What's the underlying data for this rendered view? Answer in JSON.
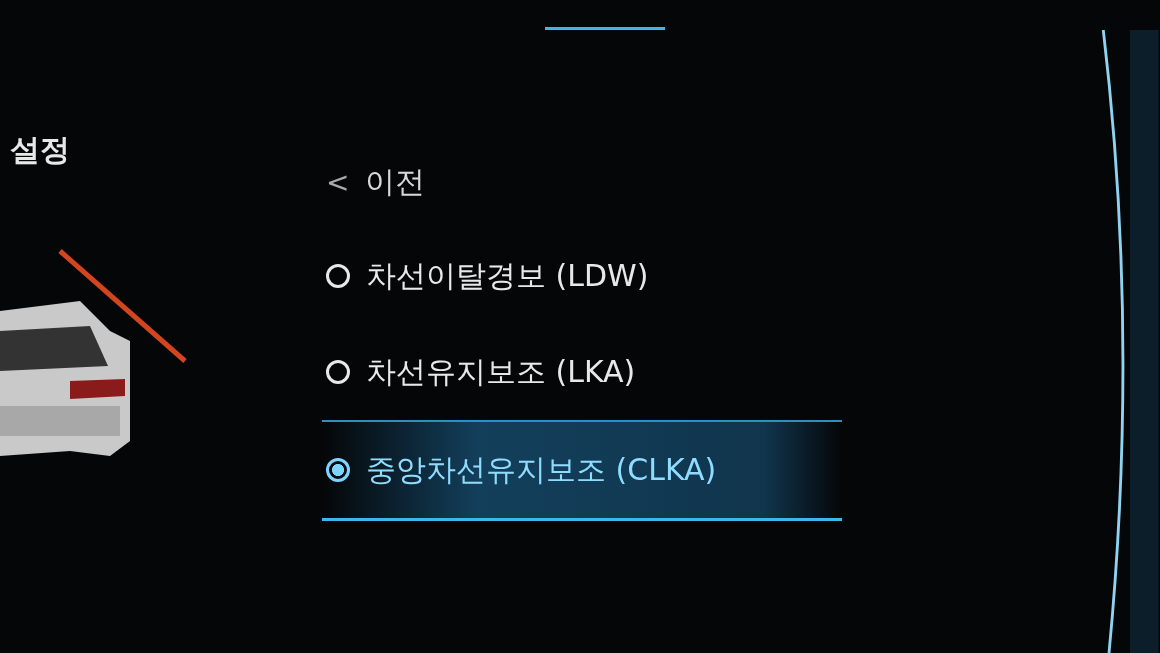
{
  "header": {
    "title": "설정"
  },
  "menu": {
    "back": {
      "icon": "<",
      "label": "이전"
    },
    "options": [
      {
        "label": "차선이탈경보 (LDW)",
        "selected": false
      },
      {
        "label": "차선유지보조 (LKA)",
        "selected": false
      },
      {
        "label": "중앙차선유지보조 (CLKA)",
        "selected": true
      }
    ]
  }
}
